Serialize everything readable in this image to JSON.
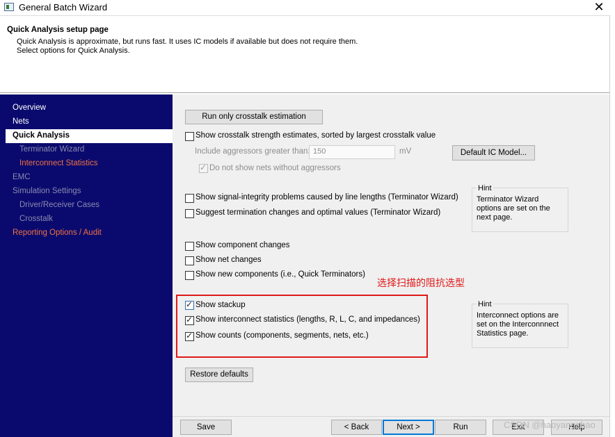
{
  "window": {
    "title": "General Batch Wizard",
    "close_glyph": "✕"
  },
  "header": {
    "title": "Quick Analysis setup page",
    "desc_line1": "Quick Analysis is approximate, but runs fast. It uses IC models if available but does not require them.",
    "desc_line2": "Select options for Quick Analysis."
  },
  "sidebar": {
    "items": [
      {
        "label": "Overview"
      },
      {
        "label": "Nets"
      },
      {
        "label": "Quick Analysis"
      },
      {
        "label": "Terminator Wizard"
      },
      {
        "label": "Interconnect Statistics"
      },
      {
        "label": "EMC"
      },
      {
        "label": "Simulation Settings"
      },
      {
        "label": "Driver/Receiver Cases"
      },
      {
        "label": "Crosstalk"
      },
      {
        "label": "Reporting Options / Audit"
      }
    ]
  },
  "main": {
    "crosstalk_button": "Run only crosstalk estimation",
    "crosstalk_strength": {
      "label": "Show crosstalk strength estimates, sorted by largest crosstalk value",
      "checked": false
    },
    "aggressors": {
      "label": "Include aggressors greater than:",
      "value": "150",
      "unit": "mV"
    },
    "default_ic_button": "Default IC Model...",
    "no_aggressors": {
      "label": "Do not show nets without aggressors",
      "checked": true
    },
    "si_problems": {
      "label": "Show signal-integrity problems caused by line lengths (Terminator Wizard)",
      "checked": false
    },
    "suggest_term": {
      "label": "Suggest termination changes and optimal values (Terminator Wizard)",
      "checked": false
    },
    "hint1": {
      "title": "Hint",
      "line1": "Terminator Wizard",
      "line2": "options are set on the",
      "line3": "next page."
    },
    "component_changes": {
      "label": "Show component changes",
      "checked": false
    },
    "net_changes": {
      "label": "Show net changes",
      "checked": false
    },
    "new_components": {
      "label": "Show new components  (i.e., Quick Terminators)",
      "checked": false
    },
    "annotation": "选择扫描的阻抗选型",
    "stackup": {
      "label": "Show stackup",
      "checked": true
    },
    "interconnect_stats": {
      "label": "Show interconnect statistics (lengths, R, L, C, and impedances)",
      "checked": true
    },
    "counts": {
      "label": "Show counts (components, segments, nets, etc.)",
      "checked": true
    },
    "hint2": {
      "title": "Hint",
      "line1": "Interconnect options are",
      "line2": "set on the Interconnnect",
      "line3": "Statistics page."
    },
    "restore_button": "Restore defaults"
  },
  "footer": {
    "save": "Save",
    "back": "< Back",
    "next": "Next >",
    "run": "Run",
    "exit": "Exit",
    "help": "Help"
  },
  "watermark": "CSDN @haoyangzhao"
}
